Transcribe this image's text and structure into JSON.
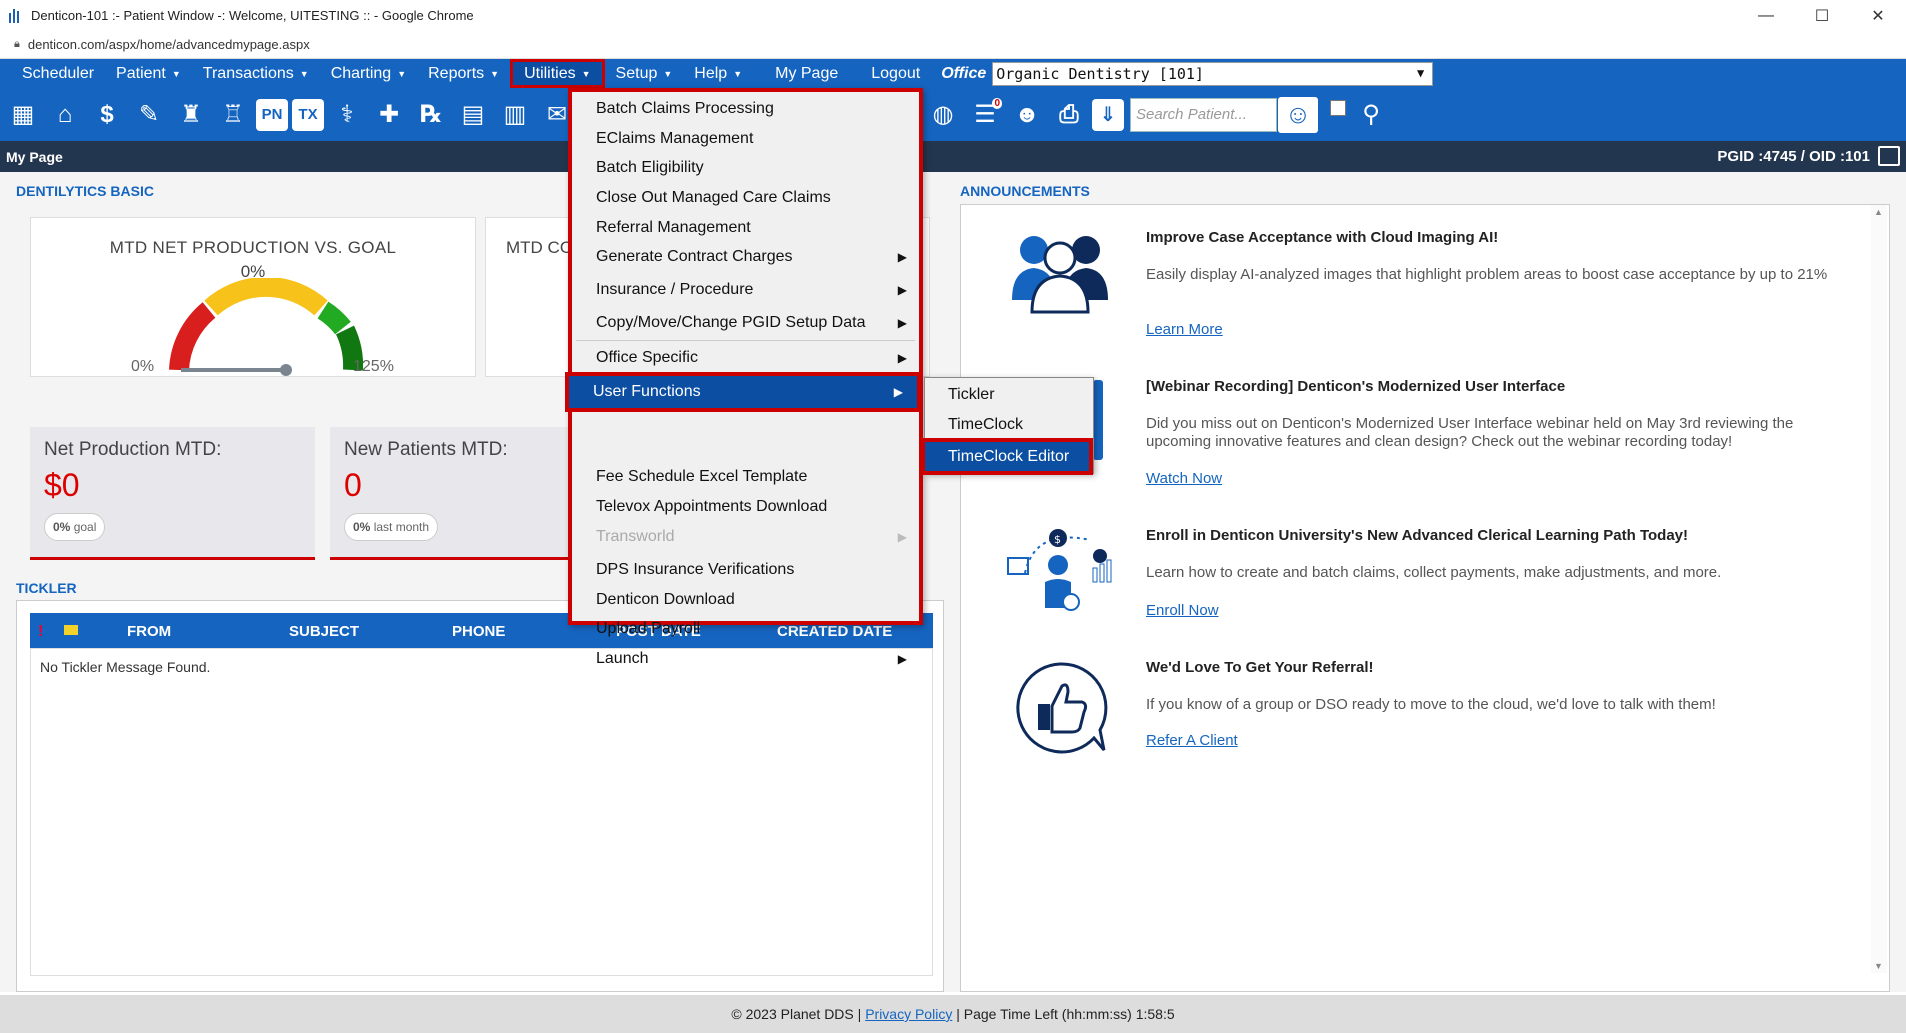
{
  "browser": {
    "title": "Denticon-101 :- Patient Window -: Welcome, UITESTING :: - Google Chrome",
    "url": "denticon.com/aspx/home/advancedmypage.aspx",
    "minimize": "—",
    "maximize": "☐",
    "close": "✕"
  },
  "menubar": {
    "items": [
      {
        "label": "Scheduler",
        "caret": false
      },
      {
        "label": "Patient",
        "caret": true
      },
      {
        "label": "Transactions",
        "caret": true
      },
      {
        "label": "Charting",
        "caret": true
      },
      {
        "label": "Reports",
        "caret": true
      },
      {
        "label": "Utilities",
        "caret": true
      },
      {
        "label": "Setup",
        "caret": true
      },
      {
        "label": "Help",
        "caret": true
      },
      {
        "label": "My Page",
        "caret": false
      },
      {
        "label": "Logout",
        "caret": false
      }
    ],
    "office_label": "Office",
    "office_value": "Organic Dentistry [101]"
  },
  "toolbar": {
    "search_placeholder": "Search Patient...",
    "badge_count": "0"
  },
  "pagebar": {
    "title": "My Page",
    "ids": "PGID :4745  /  OID :101"
  },
  "dentilytics": {
    "section_title": "DENTILYTICS BASIC",
    "gauge1": {
      "title": "MTD NET PRODUCTION VS. GOAL",
      "pct": "0%",
      "min": "0%",
      "max": "125%",
      "value": 0
    },
    "gauge2_title": "MTD CO",
    "stat1": {
      "label": "Net Production MTD:",
      "value": "$0",
      "pill_value": "0%",
      "pill_text": "goal"
    },
    "stat2": {
      "label": "New Patients MTD:",
      "value": "0",
      "pill_value": "0%",
      "pill_text": "last month"
    }
  },
  "tickler": {
    "section_title": "TICKLER",
    "columns": {
      "flag": "!",
      "from": "FROM",
      "subject": "SUBJECT",
      "phone": "PHONE",
      "post_date": "POST DATE",
      "created_date": "CREATED DATE"
    },
    "empty_message": "No Tickler Message Found."
  },
  "utilities_menu": {
    "items": [
      {
        "label": "Batch Claims Processing"
      },
      {
        "label": "EClaims Management"
      },
      {
        "label": "Batch Eligibility"
      },
      {
        "label": "Close Out Managed Care Claims"
      },
      {
        "label": "Referral Management"
      },
      {
        "label": "Generate Contract Charges"
      },
      {
        "label": "Insurance / Procedure"
      },
      {
        "label": "Copy/Move/Change PGID Setup Data"
      },
      {
        "label": "Office Specific"
      },
      {
        "label": "User Functions"
      },
      {
        "label": "Fee Schedule Excel Template"
      },
      {
        "label": "Televox Appointments Download"
      },
      {
        "label": "Transworld"
      },
      {
        "label": "DPS Insurance Verifications"
      },
      {
        "label": "Denticon Download"
      },
      {
        "label": "Upload Payroll"
      },
      {
        "label": "Launch"
      }
    ],
    "arrow": "▶"
  },
  "user_functions_menu": {
    "items": [
      {
        "label": "Tickler"
      },
      {
        "label": "TimeClock"
      },
      {
        "label": "TimeClock Editor"
      }
    ]
  },
  "announcements": {
    "section_title": "ANNOUNCEMENTS",
    "items": [
      {
        "title": "Improve Case Acceptance with Cloud Imaging AI!",
        "text": "Easily display AI-analyzed images that highlight problem areas to boost case acceptance by up to 21%",
        "link": "Learn More"
      },
      {
        "title": "[Webinar Recording] Denticon's Modernized User Interface",
        "text": "Did you miss out on Denticon's Modernized User Interface webinar held on May 3rd reviewing the upcoming innovative features and clean design? Check out the webinar recording today!",
        "link": "Watch Now"
      },
      {
        "title": "Enroll in Denticon University's New Advanced Clerical Learning Path Today!",
        "text": "Learn how to create and batch claims, collect payments, make adjustments, and more.",
        "link": "Enroll Now"
      },
      {
        "title": "We'd Love To Get Your Referral!",
        "text": "If you know of a group or DSO ready to move to the cloud, we'd love to talk with them!",
        "link": "Refer A Client"
      }
    ]
  },
  "footer": {
    "copyright": "© 2023 Planet DDS |",
    "privacy": "Privacy Policy",
    "time_left": "| Page Time Left (hh:mm:ss) 1:58:5"
  },
  "colors": {
    "brand": "#1565c0",
    "highlight": "#0b4ea2",
    "alert": "#cc0000"
  }
}
